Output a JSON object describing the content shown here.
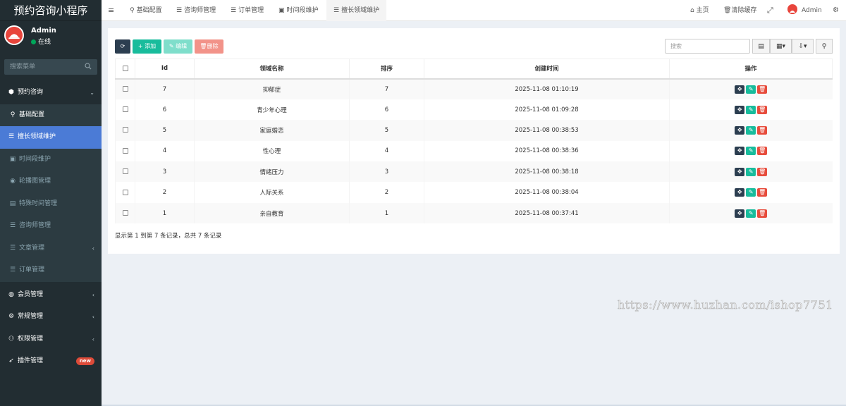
{
  "brand": "预约咨询小程序",
  "user": {
    "name": "Admin",
    "status": "在线"
  },
  "sidebar_search": {
    "placeholder": "搜索菜单"
  },
  "menu": [
    {
      "label": "预约咨询",
      "icon": "cubes-icon",
      "glyph": "⬢",
      "type": "top",
      "caret": "⌄"
    },
    {
      "label": "基础配置",
      "icon": "map-marker-icon",
      "glyph": "⚲",
      "type": "sub-highlight"
    },
    {
      "label": "擅长领域维护",
      "icon": "list-icon",
      "glyph": "☰",
      "type": "active"
    },
    {
      "label": "时间段维护",
      "icon": "image-icon",
      "glyph": "▣",
      "type": "sub"
    },
    {
      "label": "轮播图管理",
      "icon": "circle-icon",
      "glyph": "◉",
      "type": "sub"
    },
    {
      "label": "特殊时间管理",
      "icon": "file-icon",
      "glyph": "▤",
      "type": "sub"
    },
    {
      "label": "咨询师管理",
      "icon": "list-icon",
      "glyph": "☰",
      "type": "sub"
    },
    {
      "label": "文章管理",
      "icon": "list-icon",
      "glyph": "☰",
      "type": "sub",
      "caret": "‹"
    },
    {
      "label": "订单管理",
      "icon": "list-icon",
      "glyph": "☰",
      "type": "sub"
    },
    {
      "label": "会员管理",
      "icon": "user-circle-icon",
      "glyph": "◍",
      "type": "top",
      "caret": "‹"
    },
    {
      "label": "常规管理",
      "icon": "cogs-icon",
      "glyph": "⚙",
      "type": "top",
      "caret": "‹"
    },
    {
      "label": "权限管理",
      "icon": "group-icon",
      "glyph": "⚇",
      "type": "top",
      "caret": "‹"
    },
    {
      "label": "插件管理",
      "icon": "rocket-icon",
      "glyph": "➶",
      "type": "top",
      "badge": "new"
    }
  ],
  "topnav": {
    "toggle_glyph": "≡",
    "tabs": [
      {
        "label": "基础配置",
        "glyph": "⚲",
        "icon": "map-marker-icon"
      },
      {
        "label": "咨询师管理",
        "glyph": "☰",
        "icon": "list-icon"
      },
      {
        "label": "订单管理",
        "glyph": "☰",
        "icon": "list-icon"
      },
      {
        "label": "时间段维护",
        "glyph": "▣",
        "icon": "image-icon"
      },
      {
        "label": "擅长领域维护",
        "glyph": "☰",
        "icon": "list-icon"
      }
    ],
    "home": "主页",
    "clear_cache": "清除缓存",
    "fullscreen_glyph": "⤢",
    "admin": "Admin"
  },
  "toolbar": {
    "refresh_glyph": "⟳",
    "add": "添加",
    "add_glyph": "+",
    "edit": "编辑",
    "edit_glyph": "✎",
    "delete": "删除",
    "delete_glyph": "🗑",
    "search_placeholder": "搜索",
    "view_glyph": "▤",
    "columns_glyph": "▦",
    "export_glyph": "⇩",
    "search_glyph": "⚲"
  },
  "table": {
    "headers": [
      "Id",
      "领域名称",
      "排序",
      "创建时间",
      "操作"
    ],
    "rows": [
      {
        "id": "7",
        "name": "抑郁症",
        "sort": "7",
        "created": "2025-11-08 01:10:19"
      },
      {
        "id": "6",
        "name": "青少年心理",
        "sort": "6",
        "created": "2025-11-08 01:09:28"
      },
      {
        "id": "5",
        "name": "家庭婚恋",
        "sort": "5",
        "created": "2025-11-08 00:38:53"
      },
      {
        "id": "4",
        "name": "性心理",
        "sort": "4",
        "created": "2025-11-08 00:38:36"
      },
      {
        "id": "3",
        "name": "情绪压力",
        "sort": "3",
        "created": "2025-11-08 00:38:18"
      },
      {
        "id": "2",
        "name": "人际关系",
        "sort": "2",
        "created": "2025-11-08 00:38:04"
      },
      {
        "id": "1",
        "name": "亲自教育",
        "sort": "1",
        "created": "2025-11-08 00:37:41"
      }
    ],
    "op_glyphs": {
      "drag": "✥",
      "edit": "✎",
      "delete": "🗑"
    }
  },
  "pagination_info": "显示第 1 到第 7 条记录，总共 7 条记录",
  "watermark": "https://www.huzhan.com/ishop7751",
  "colors": {
    "sidebar": "#222d32",
    "active": "#4b7bd6",
    "primary": "#18bc9c",
    "danger": "#e74c3c",
    "dark": "#2c3e50"
  }
}
